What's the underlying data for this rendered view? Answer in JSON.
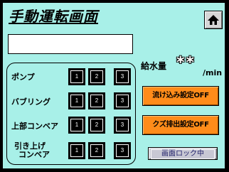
{
  "screen": {
    "title": "手動運転画面",
    "message": ""
  },
  "nav": {
    "home_icon": "home-icon"
  },
  "controls": {
    "rows": [
      {
        "label": "ポンプ",
        "buttons": [
          "1",
          "2",
          "3"
        ]
      },
      {
        "label": "バブリング",
        "buttons": [
          "1",
          "2",
          "3"
        ]
      },
      {
        "label": "上部コンベア",
        "buttons": [
          "1",
          "2",
          "3"
        ]
      },
      {
        "label_line1": "引き上げ",
        "label_line2": "コンベア",
        "buttons": [
          "1",
          "2",
          "3"
        ]
      }
    ]
  },
  "water_supply": {
    "label": "給水量",
    "value": "**",
    "unit": "/min"
  },
  "buttons": {
    "flush_setting": "流け込み設定OFF",
    "waste_setting": "クズ排出設定OFF",
    "screen_lock": "画面ロック中"
  },
  "colors": {
    "background": "#a8f0e8",
    "orange": "#ff8c1a",
    "lock_button": "#c8c8d4"
  }
}
